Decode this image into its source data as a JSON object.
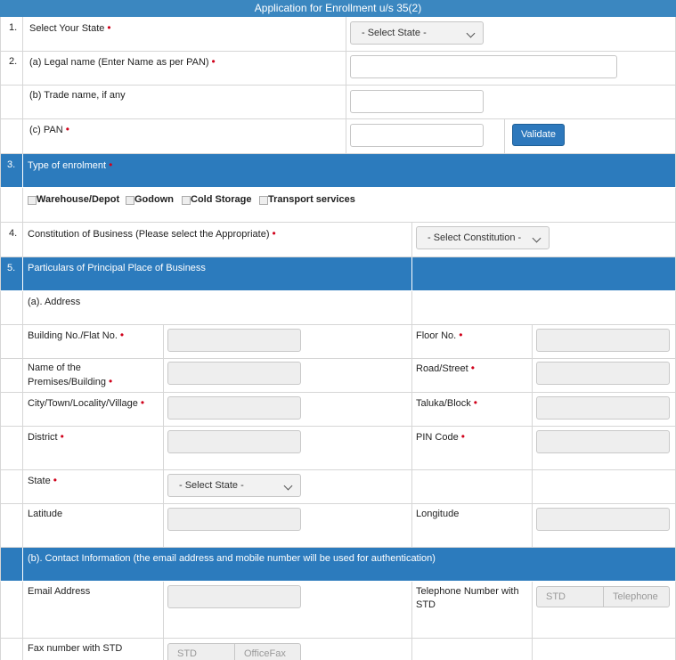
{
  "header": {
    "title": "Application for Enrollment u/s 35(2)"
  },
  "s1": {
    "num": "1.",
    "label": "Select Your State",
    "select": "- Select State -"
  },
  "s2": {
    "num": "2.",
    "legal_label": "(a) Legal name (Enter Name as per PAN)",
    "trade_label": "(b) Trade name, if any",
    "pan_label": "(c) PAN",
    "validate": "Validate"
  },
  "s3": {
    "num": "3.",
    "label": "Type of enrolment",
    "options": [
      "Warehouse/Depot",
      "Godown",
      "Cold Storage",
      "Transport services"
    ]
  },
  "s4": {
    "num": "4.",
    "label": "Constitution of Business (Please select the Appropriate)",
    "select": "- Select Constitution -"
  },
  "s5": {
    "num": "5.",
    "label": "Particulars of Principal Place of Business",
    "address": "(a). Address",
    "building": "Building No./Flat No.",
    "floor": "Floor No.",
    "premises_1": "Name of the",
    "premises_2": "Premises/Building",
    "road": "Road/Street",
    "city": "City/Town/Locality/Village",
    "taluka": "Taluka/Block",
    "district": "District",
    "pin": "PIN Code",
    "state": "State",
    "state_select": "- Select State -",
    "latitude": "Latitude",
    "longitude": "Longitude",
    "contact": "(b). Contact Information (the email address and mobile number will be used for authentication)",
    "email": "Email Address",
    "tel_1": "Telephone Number with",
    "tel_2": "STD",
    "std_ph": "STD",
    "tel_ph": "Telephone",
    "fax": "Fax number with STD",
    "fax_std_ph": "STD",
    "fax_ph": "OfficeFax"
  },
  "colors": {
    "accent": "#2c7bbd",
    "required": "#d0021b"
  }
}
